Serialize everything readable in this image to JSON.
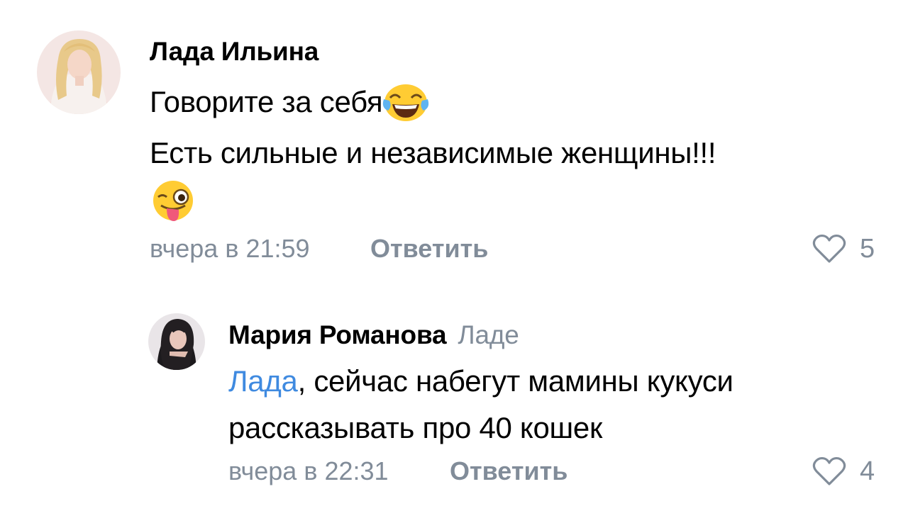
{
  "comments": [
    {
      "author": "Лада Ильина",
      "text_lines": [
        "Говорите за себя",
        "Есть сильные и независимые женщины!!!"
      ],
      "emojis": [
        "face-with-tears-of-joy",
        "winking-face-with-tongue"
      ],
      "timestamp": "вчера в 21:59",
      "reply_label": "Ответить",
      "likes": "5"
    },
    {
      "author": "Мария Романова",
      "reply_to": "Ладе",
      "mention": "Лада",
      "text_line1_rest": ", сейчас набегут мамины кукуси",
      "text_line2": "рассказывать про 40 кошек",
      "timestamp": "вчера в 22:31",
      "reply_label": "Ответить",
      "likes": "4"
    }
  ],
  "colors": {
    "secondary_text": "#818c99",
    "mention": "#3f8ae0",
    "primary_text": "#000000"
  }
}
